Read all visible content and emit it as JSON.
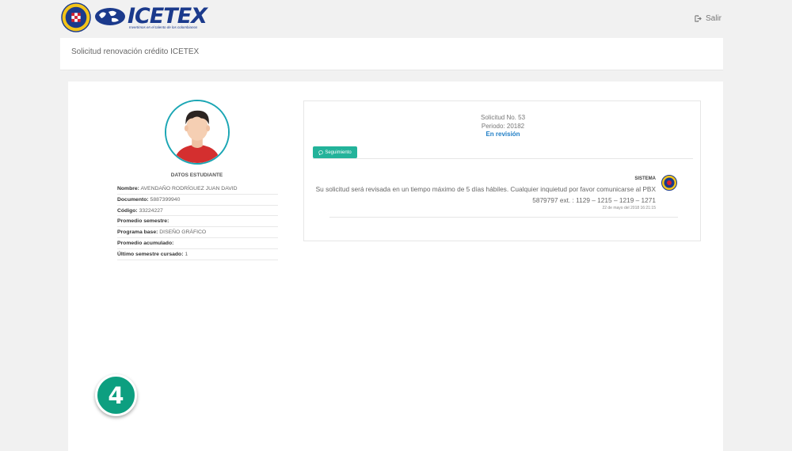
{
  "header": {
    "logo_word": "ICETEX",
    "logo_tagline": "Invertimos en el talento de los colombianos",
    "logout_label": "Salir"
  },
  "page_title": "Solicitud renovación crédito ICETEX",
  "student": {
    "section_title": "DATOS ESTUDIANTE",
    "fields": [
      {
        "label": "Nombre:",
        "value": "AVENDAÑO RODRÍGUEZ JUAN DAVID"
      },
      {
        "label": "Documento:",
        "value": "5887399940"
      },
      {
        "label": "Código:",
        "value": "33224227"
      },
      {
        "label": "Promedio semestre:",
        "value": ""
      },
      {
        "label": "Programa base:",
        "value": "DISEÑO GRÁFICO"
      },
      {
        "label": "Promedio acumulado:",
        "value": ""
      },
      {
        "label": "Último semestre cursado:",
        "value": "1"
      }
    ]
  },
  "request": {
    "number_label": "Solicitud No. 53",
    "period_label": "Periodo: 20182",
    "status": "En revisión",
    "status_color": "#1f7ec6",
    "tab_label": "Seguimiento",
    "tab_color": "#23b39a"
  },
  "message": {
    "author": "SISTEMA",
    "body": "Su solicitud será revisada en un tiempo máximo de 5 días hábiles. Cualquier inquietud por favor comunicarse al PBX 5879797 ext. : 1129 – 1215 – 1219 – 1271",
    "date": "22 de mayo del 2018 16:21:15"
  },
  "step_badge": "4",
  "colors": {
    "brand": "#1b3a8c",
    "accent": "#1ba6b4",
    "badge": "#0d9f80"
  }
}
